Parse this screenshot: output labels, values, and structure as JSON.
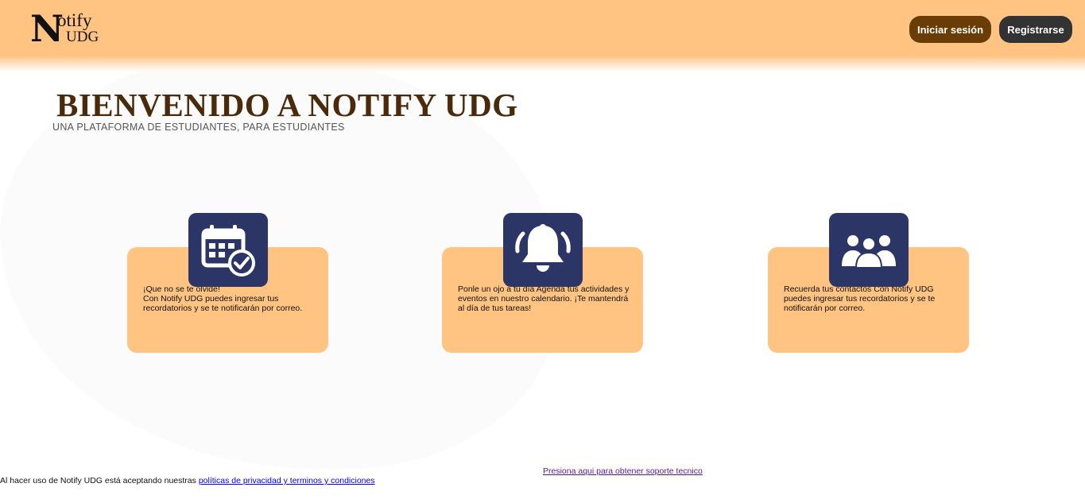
{
  "header": {
    "logo": {
      "n": "N",
      "otify": "otify",
      "udg": "UDG"
    },
    "buttons": {
      "login": "Iniciar sesión",
      "register": "Registrarse"
    },
    "colors": {
      "bar": "#ffc382",
      "login": "#6b3d06",
      "register": "#333333"
    }
  },
  "hero": {
    "title": "BIENVENIDO A NOTIFY UDG",
    "subtitle": "UNA PLATAFORMA DE ESTUDIANTES, PARA ESTUDIANTES"
  },
  "cards": [
    {
      "icon": "calendar-check-icon",
      "line1": "¡Que no se te olvide!",
      "line2": "Con Notify UDG puedes ingresar tus recordatorios y se te notificarán por correo."
    },
    {
      "icon": "bell-icon",
      "line1": "Ponle un ojo a tu día Agenda tus actividades y eventos en nuestro calendario. ¡Te mantendrá al día de tus tareas!",
      "line2": ""
    },
    {
      "icon": "contacts-group-icon",
      "line1": "Recuerda tus contactos Con Notify UDG puedes ingresar tus recordatorios y se te notificarán por correo.",
      "line2": ""
    }
  ],
  "footer": {
    "support_link": "Presiona aqui para obtener soporte tecnico",
    "legal_prefix": "Al hacer uso de Notify UDG está aceptando nuestras",
    "legal_link": "políticas de privacidad y terminos y condiciones"
  },
  "colors": {
    "icon_box": "#2b3566",
    "card": "#ffc382",
    "title": "#4a2a0a"
  }
}
